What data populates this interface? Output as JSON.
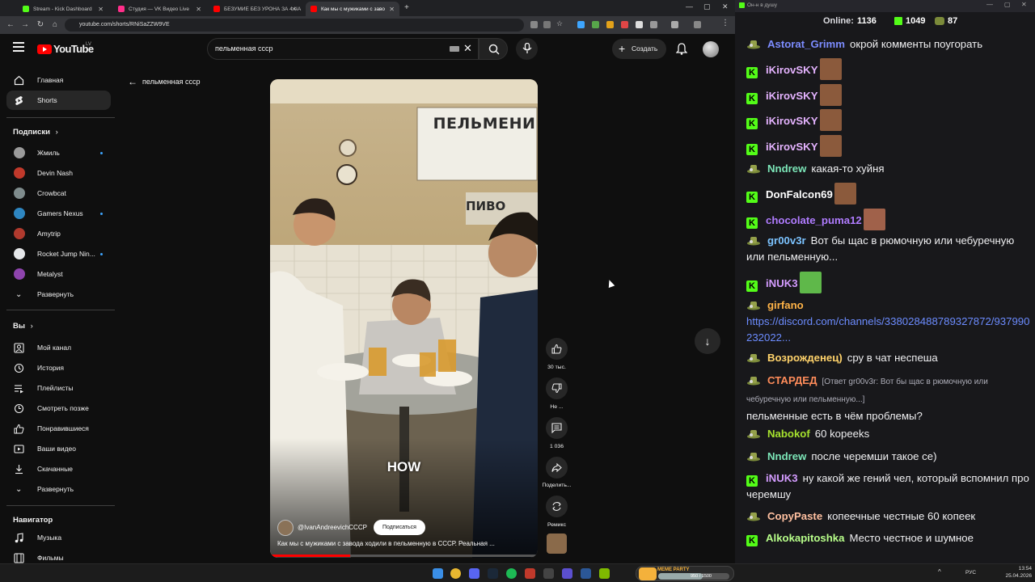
{
  "browser": {
    "tabs": [
      {
        "label": "Stream - Kick Dashboard",
        "color": "#53fc18"
      },
      {
        "label": "Студия — VK Видео Live",
        "color": "#ff2e8a"
      },
      {
        "label": "БЕЗУМИЕ БЕЗ УРОНА ЗА 4 ЧА",
        "color": "#ff0000"
      },
      {
        "label": "Как мы с мужиками с заво",
        "color": "#ff0000"
      }
    ],
    "url": "youtube.com/shorts/RNiSaZZW9VE"
  },
  "youtube": {
    "logo_text": "YouTube",
    "logo_region": "LV",
    "search_value": "пельменная ссср",
    "create_label": "Создать",
    "back_label": "пельменная ссср",
    "sidebar": {
      "main": [
        {
          "label": "Главная",
          "icon": "home-icon"
        },
        {
          "label": "Shorts",
          "icon": "shorts-icon",
          "active": true
        }
      ],
      "subs_header": "Подписки",
      "subs": [
        {
          "label": "Жмиль",
          "color": "#9a9a9a",
          "dot": true
        },
        {
          "label": "Devin Nash",
          "color": "#c0392b",
          "dot": false
        },
        {
          "label": "Crowbcat",
          "color": "#7f8c8d",
          "dot": false
        },
        {
          "label": "Gamers Nexus",
          "color": "#2e86c1",
          "dot": true
        },
        {
          "label": "Amytrip",
          "color": "#b03a2e",
          "dot": false
        },
        {
          "label": "Rocket Jump Nin...",
          "color": "#e5e7e9",
          "dot": true
        },
        {
          "label": "Metalyst",
          "color": "#8e44ad",
          "dot": false
        }
      ],
      "expand_label": "Развернуть",
      "you_header": "Вы",
      "you": [
        {
          "label": "Мой канал",
          "icon": "channel-icon"
        },
        {
          "label": "История",
          "icon": "history-icon"
        },
        {
          "label": "Плейлисты",
          "icon": "playlist-icon"
        },
        {
          "label": "Смотреть позже",
          "icon": "watch-later-icon"
        },
        {
          "label": "Понравившиеся",
          "icon": "like-icon"
        },
        {
          "label": "Ваши видео",
          "icon": "video-icon"
        },
        {
          "label": "Скачанные",
          "icon": "download-icon"
        },
        {
          "label": "Развернуть",
          "icon": "chevron-down-icon"
        }
      ],
      "nav_header": "Навигатор",
      "nav": [
        {
          "label": "Музыка",
          "icon": "music-icon"
        },
        {
          "label": "Фильмы",
          "icon": "film-icon"
        }
      ]
    },
    "short": {
      "caption": "HOW",
      "channel": "@IvanAndreevichCCCP",
      "subscribe_label": "Подписаться",
      "title": "Как мы с мужиками с завода ходили в пельменную в СССР. Реальная ...",
      "sign_main": "ПЕЛЬМЕНИ",
      "sign_beer": "ПИВО",
      "likes": "30 тыс.",
      "dislike_label": "Не ...",
      "comments": "1 036",
      "share_label": "Поделить...",
      "remix_label": "Ремикс"
    }
  },
  "chat": {
    "window_title": "Он-н в душу",
    "online_label": "Online:",
    "online_count": "1136",
    "kick_count": "1049",
    "other_count": "87",
    "messages": [
      {
        "user": "Astorat_Grimm",
        "color": "#7c8cff",
        "badge": "hat",
        "text": "окрой комменты поугорать"
      },
      {
        "user": "iKirovSKY",
        "color": "#e5b3ff",
        "badge": "kick",
        "text": "",
        "emote": true
      },
      {
        "user": "iKirovSKY",
        "color": "#e5b3ff",
        "badge": "kick",
        "text": "",
        "emote": true
      },
      {
        "user": "iKirovSKY",
        "color": "#e5b3ff",
        "badge": "kick",
        "text": "",
        "emote": true
      },
      {
        "user": "iKirovSKY",
        "color": "#e5b3ff",
        "badge": "kick",
        "text": "",
        "emote": true
      },
      {
        "user": "Nndrew",
        "color": "#7ce6b8",
        "badge": "hat",
        "text": "какая-то хуйня"
      },
      {
        "user": "DonFalcon69",
        "color": "#ffffff",
        "badge": "kick",
        "text": "",
        "emote": true
      },
      {
        "user": "chocolate_puma12",
        "color": "#b07cff",
        "badge": "kick",
        "text": "",
        "emote": true
      },
      {
        "user": "gr00v3r",
        "color": "#7cc3ff",
        "badge": "hat",
        "text": "Вот бы щас в рюмочную или чебуречную или пельменную..."
      },
      {
        "user": "iNUK3",
        "color": "#d49cff",
        "badge": "kick",
        "text": "",
        "emote": true
      },
      {
        "user": "girfano",
        "color": "#ffb347",
        "badge": "hat",
        "text": "",
        "link": "https://discord.com/channels/338028488789327872/937990232022..."
      },
      {
        "user": "Возрожденец)",
        "color": "#ffd36b",
        "badge": "hat",
        "text": "сру в чат неспеша"
      },
      {
        "user": "СТАРДЕД",
        "color": "#ff8c5a",
        "badge": "hat",
        "reply": "[Ответ gr00v3r: Вот бы щас в рюмочную или чебуречную или пельменную...]",
        "text": "пельменные есть в чём проблемы?"
      },
      {
        "user": "Nabokof",
        "color": "#a6e22e",
        "badge": "hat",
        "text": "60 kopeeks"
      },
      {
        "user": "Nndrew",
        "color": "#7ce6b8",
        "badge": "hat",
        "text": "после черемши такое се)"
      },
      {
        "user": "iNUK3",
        "color": "#d49cff",
        "badge": "kick",
        "text": "ну какой же гений чел, который вспомнил про черемшу"
      },
      {
        "user": "CopyPaste",
        "color": "#ffc0a0",
        "badge": "hat",
        "text": "копеечные честные 60 копеек"
      },
      {
        "user": "Alkokapitoshka",
        "color": "#b8ff8a",
        "badge": "kick",
        "text": "Место честное и шумное"
      }
    ]
  },
  "taskbar": {
    "widget_label": "MEME PARTY",
    "widget_progress": "950 / 1500",
    "lang": "РУС",
    "time": "13:54",
    "date": "25.04.2026"
  }
}
